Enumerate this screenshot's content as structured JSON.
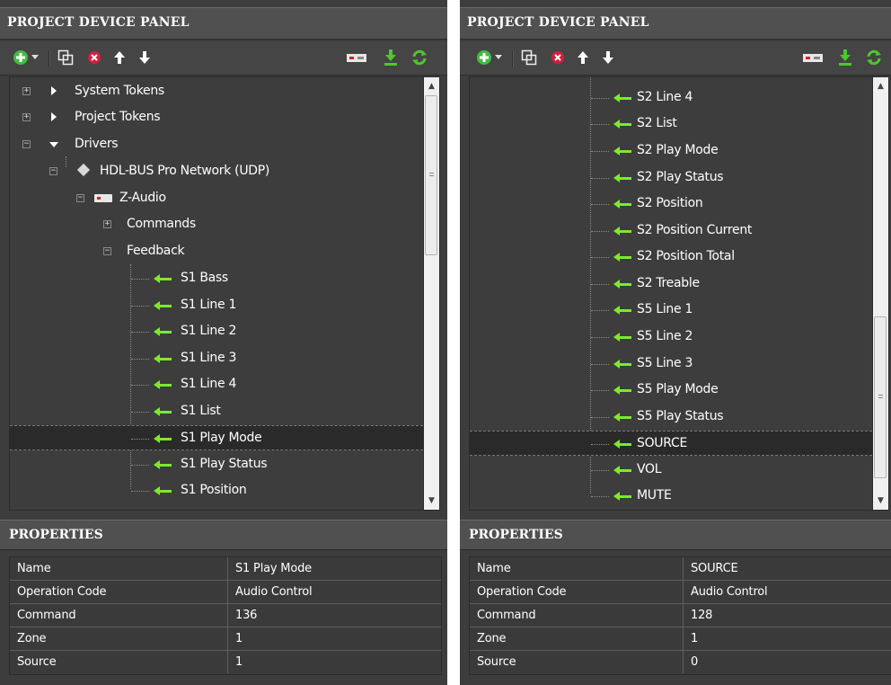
{
  "left": {
    "header": "PROJECT DEVICE PANEL",
    "tree": {
      "system_tokens": "System Tokens",
      "project_tokens": "Project Tokens",
      "drivers": "Drivers",
      "network": "HDL-BUS Pro Network (UDP)",
      "device": "Z-Audio",
      "commands": "Commands",
      "feedback": "Feedback",
      "items": [
        "S1 Bass",
        "S1 Line 1",
        "S1 Line 2",
        "S1 Line 3",
        "S1 Line 4",
        "S1 List",
        "S1 Play Mode",
        "S1 Play Status",
        "S1 Position"
      ],
      "selected_index": 6
    },
    "properties": {
      "title": "PROPERTIES",
      "rows": [
        {
          "key": "Name",
          "value": "S1 Play Mode"
        },
        {
          "key": "Operation Code",
          "value": "Audio Control"
        },
        {
          "key": "Command",
          "value": "136"
        },
        {
          "key": "Zone",
          "value": "1"
        },
        {
          "key": "Source",
          "value": "1"
        }
      ]
    }
  },
  "right": {
    "header": "PROJECT DEVICE PANEL",
    "tree": {
      "items": [
        "S2 Line 4",
        "S2 List",
        "S2 Play Mode",
        "S2 Play Status",
        "S2 Position",
        "S2 Position Current",
        "S2 Position Total",
        "S2 Treable",
        "S5 Line 1",
        "S5 Line 2",
        "S5 Line 3",
        "S5 Play Mode",
        "S5 Play Status",
        "SOURCE",
        "VOL",
        "MUTE"
      ],
      "selected_index": 13
    },
    "properties": {
      "title": "PROPERTIES",
      "rows": [
        {
          "key": "Name",
          "value": "SOURCE"
        },
        {
          "key": "Operation Code",
          "value": "Audio Control"
        },
        {
          "key": "Command",
          "value": "128"
        },
        {
          "key": "Zone",
          "value": "1"
        },
        {
          "key": "Source",
          "value": "0"
        }
      ]
    }
  },
  "icons": [
    "add-icon",
    "dropdown-arrow-icon",
    "duplicate-icon",
    "delete-icon",
    "move-up-icon",
    "move-down-icon",
    "device-icon",
    "download-icon",
    "refresh-icon"
  ],
  "colors": {
    "feedback_arrow": "#7dea2a",
    "delete": "#d0203c",
    "panel_bg": "#3d3d3d"
  }
}
